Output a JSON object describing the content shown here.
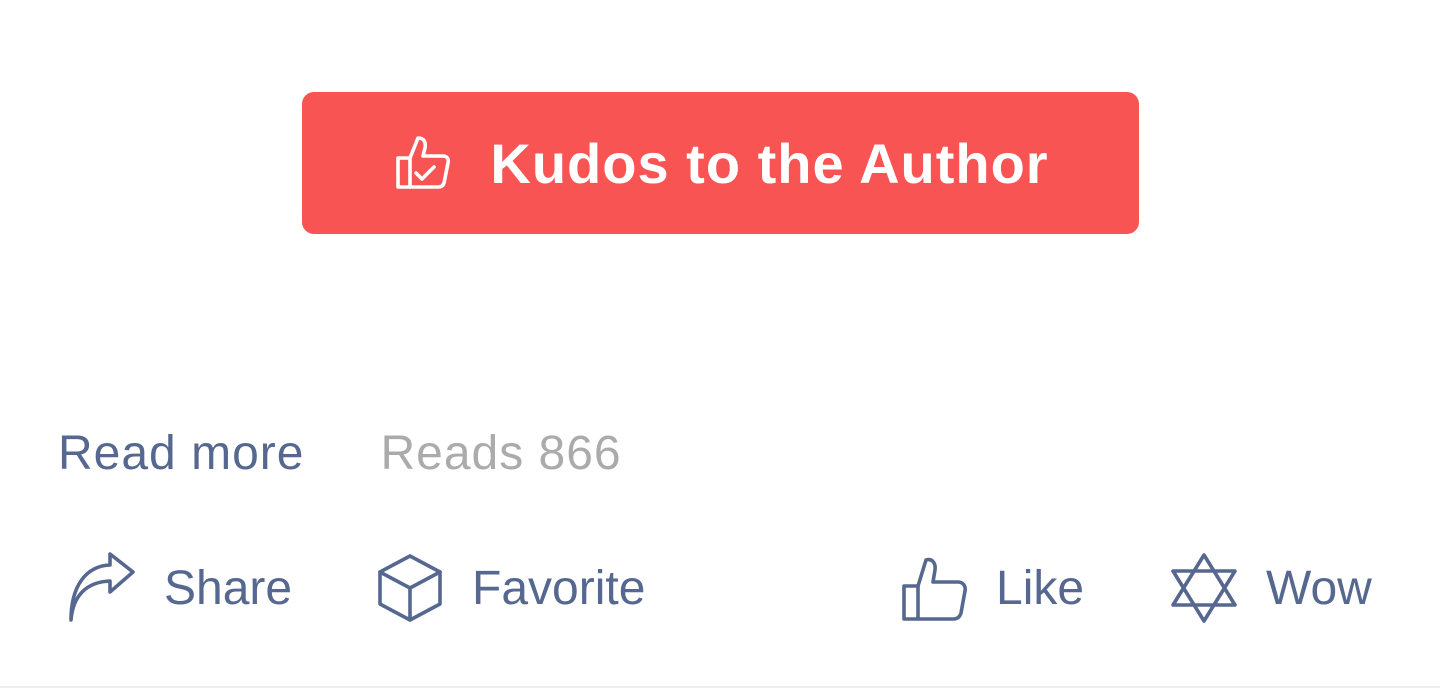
{
  "colors": {
    "accent": "#f95454",
    "link": "#56688f",
    "muted": "#ababab",
    "button_text": "#ffffff"
  },
  "kudos": {
    "label": "Kudos to the Author",
    "icon": "thumbs-up-check-icon"
  },
  "meta": {
    "read_more": "Read more",
    "reads": "Reads 866"
  },
  "actions": [
    {
      "label": "Share",
      "icon": "share-arrow-icon"
    },
    {
      "label": "Favorite",
      "icon": "cube-icon"
    },
    {
      "label": "Like",
      "icon": "thumbs-up-icon"
    },
    {
      "label": "Wow",
      "icon": "star-of-david-icon"
    }
  ]
}
